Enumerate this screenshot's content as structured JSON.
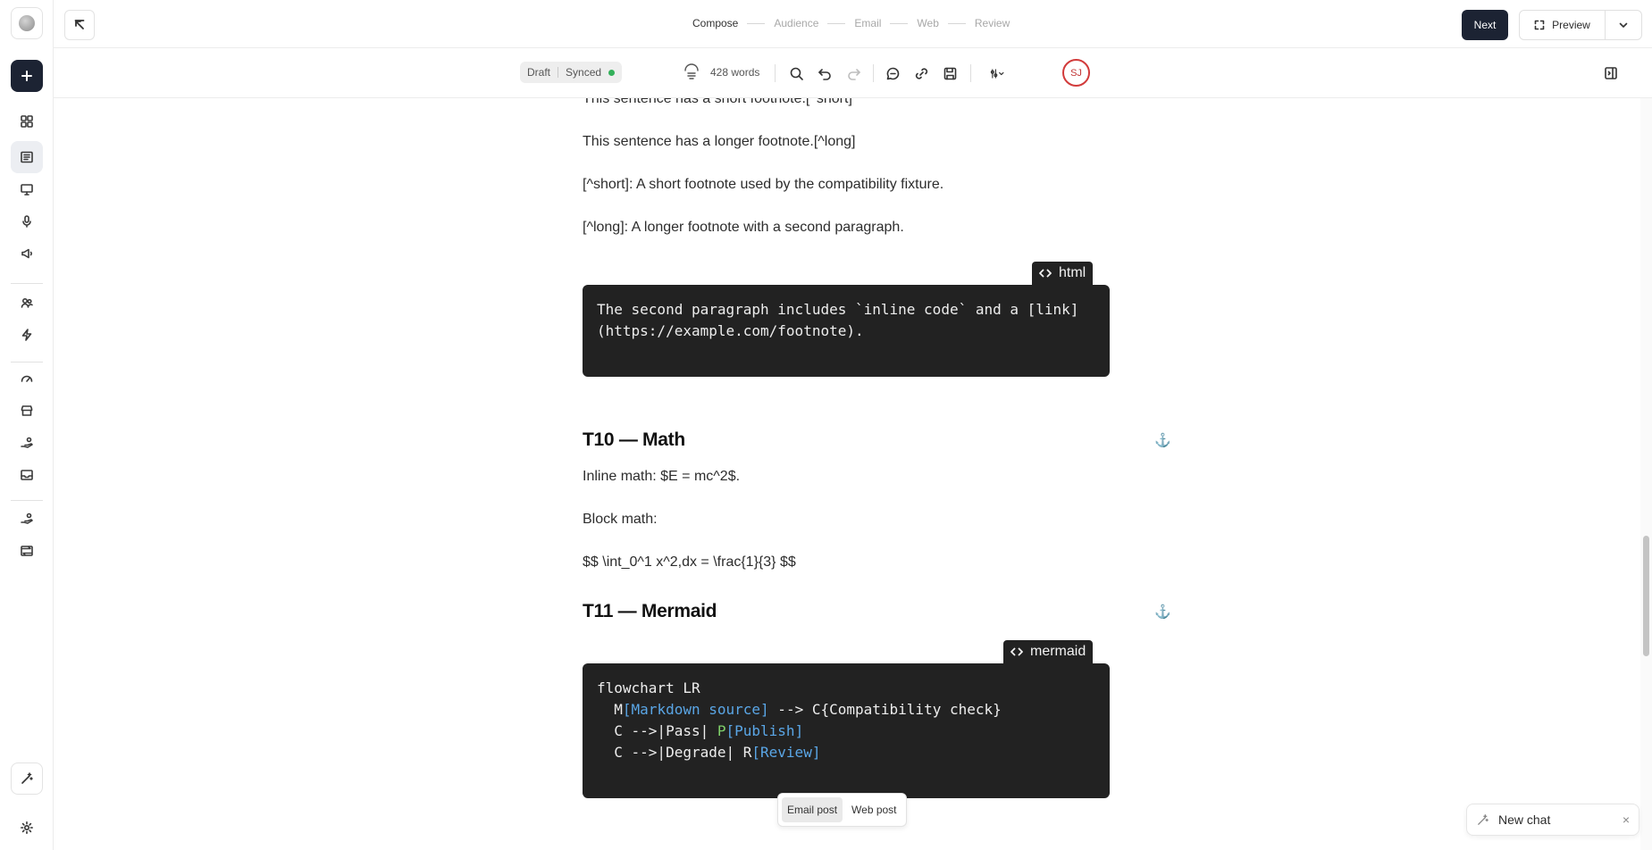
{
  "topbar": {
    "steps": [
      "Compose",
      "Audience",
      "Email",
      "Web",
      "Review"
    ],
    "next_label": "Next",
    "preview_label": "Preview"
  },
  "toolbar": {
    "draft_label": "Draft",
    "synced_label": "Synced",
    "word_count": "428 words",
    "avatar_initials": "SJ"
  },
  "editor": {
    "para_short_footnote": "This sentence has a short footnote.[^short]",
    "para_long_footnote": "This sentence has a longer footnote.[^long]",
    "para_short_def": "[^short]: A short footnote used by the compatibility fixture.",
    "para_long_def": "[^long]: A longer footnote with a second paragraph.",
    "code1_lang": "html",
    "code1_line1": "The second paragraph includes `inline code` and a [link]",
    "code1_line2": "(https://example.com/footnote).",
    "math_heading": "T10 — Math",
    "inline_math": "Inline math: $E = mc^2$.",
    "block_math_label": "Block math:",
    "block_math": "$$ \\int_0^1 x^2,dx = \\frac{1}{3} $$",
    "mermaid_heading": "T11 — Mermaid",
    "code2_lang": "mermaid",
    "mermaid": {
      "l1": "flowchart LR",
      "l2_a": "  M",
      "l2_b": "[Markdown source]",
      "l2_c": " --> C{Compatibility check}",
      "l3_a": "  C -->|Pass| ",
      "l3_b": "P",
      "l3_c": "[Publish]",
      "l4_a": "  C -->|Degrade| R",
      "l4_b": "[Review]"
    }
  },
  "post_switch": {
    "email": "Email post",
    "web": "Web post"
  },
  "chat": {
    "new_chat": "New chat",
    "close": "×"
  },
  "colors": {
    "accent_dark": "#1c2333",
    "code_bg": "#222222",
    "synced": "#33b05a",
    "avatar": "#d23b3b"
  }
}
